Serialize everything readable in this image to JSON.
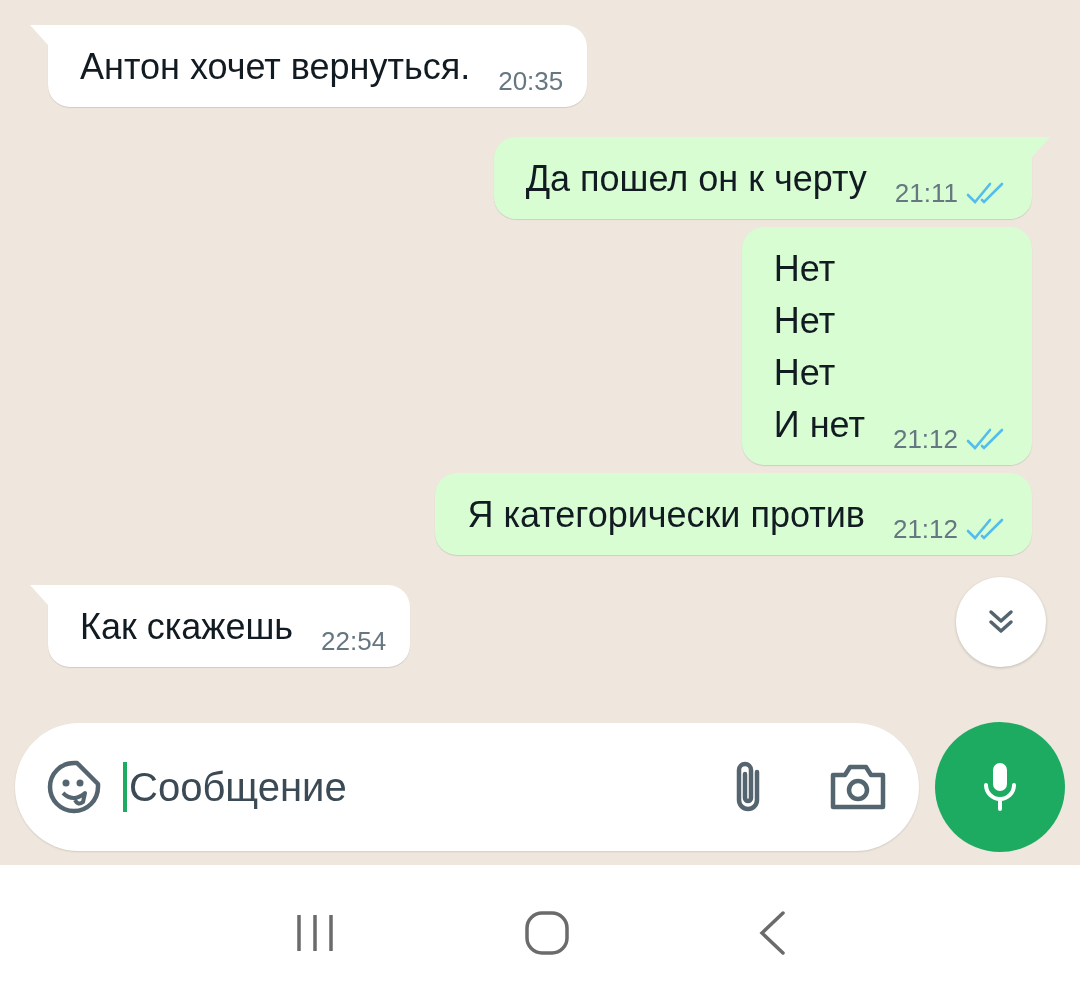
{
  "messages": [
    {
      "kind": "incoming",
      "tail": true,
      "text": "Антон хочет вернуться.",
      "time": "20:35"
    },
    {
      "kind": "outgoing",
      "tail": true,
      "text": "Да пошел он к черту",
      "time": "21:11",
      "read": true
    },
    {
      "kind": "outgoing",
      "tail": false,
      "text": "Нет\nНет\nНет\nИ нет",
      "time": "21:12",
      "read": true
    },
    {
      "kind": "outgoing",
      "tail": false,
      "text": "Я категорически против",
      "time": "21:12",
      "read": true
    },
    {
      "kind": "incoming",
      "tail": true,
      "text": "Как скажешь",
      "time": "22:54"
    }
  ],
  "composer": {
    "placeholder": "Сообщение"
  }
}
